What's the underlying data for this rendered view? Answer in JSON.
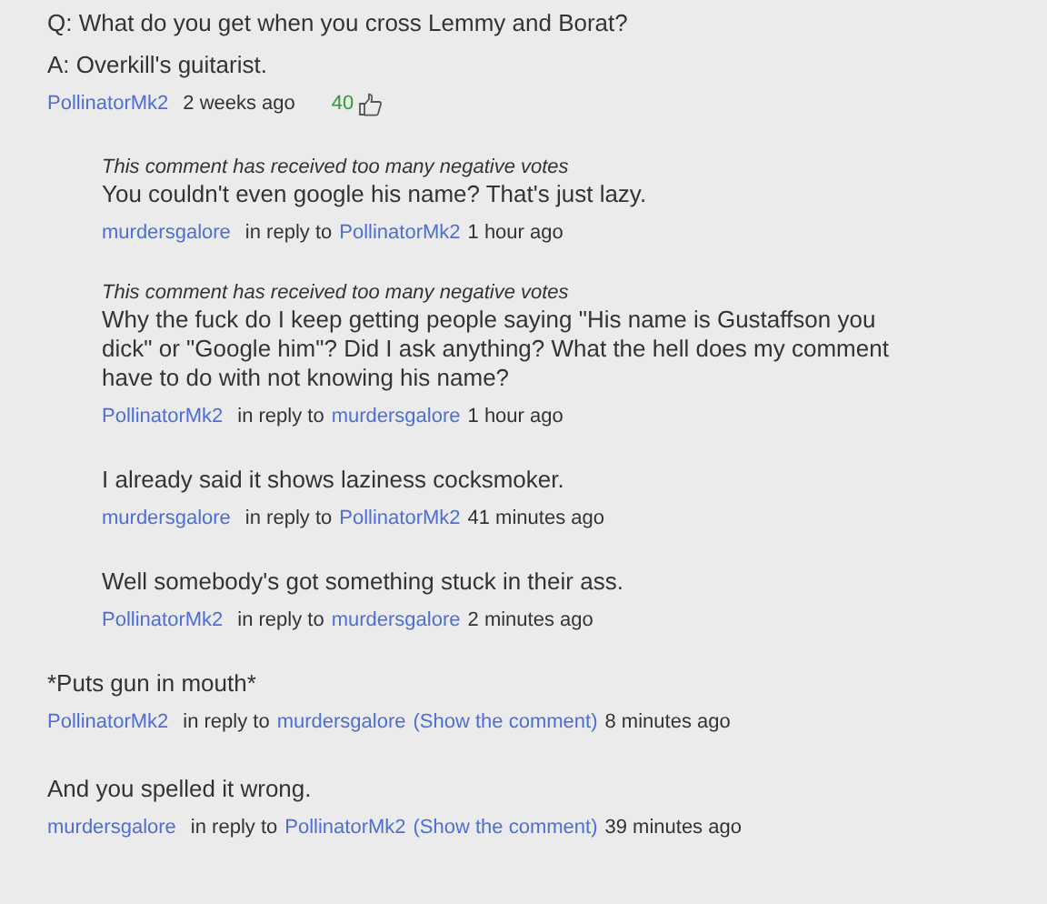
{
  "comments": [
    {
      "lines": [
        "Q: What do you get when you cross Lemmy and Borat?",
        "A: Overkill's guitarist."
      ],
      "author": "PollinatorMk2",
      "time": "2 weeks ago",
      "likes": "40",
      "children": [
        {
          "notice": "This comment has received too many negative votes",
          "lines": [
            "You couldn't even google his name? That's just lazy."
          ],
          "author": "murdersgalore",
          "reply_label": "in reply to",
          "reply_to": "PollinatorMk2",
          "time": "1 hour ago"
        },
        {
          "notice": "This comment has received too many negative votes",
          "lines": [
            "Why the fuck do I keep getting people saying \"His name is Gustaffson you dick\" or \"Google him\"? Did I ask anything? What the hell does my comment have to do with not knowing his name?"
          ],
          "author": "PollinatorMk2",
          "reply_label": "in reply to",
          "reply_to": "murdersgalore",
          "time": "1 hour ago"
        },
        {
          "lines": [
            "I already said it shows laziness cocksmoker."
          ],
          "author": "murdersgalore",
          "reply_label": "in reply to",
          "reply_to": "PollinatorMk2",
          "time": "41 minutes ago"
        },
        {
          "lines": [
            "Well somebody's got something stuck in their ass."
          ],
          "author": "PollinatorMk2",
          "reply_label": "in reply to",
          "reply_to": "murdersgalore",
          "time": "2 minutes ago"
        }
      ]
    },
    {
      "lines": [
        "*Puts gun in mouth*"
      ],
      "author": "PollinatorMk2",
      "reply_label": "in reply to",
      "reply_to": "murdersgalore",
      "show_link": "(Show the comment)",
      "time": "8 minutes ago"
    },
    {
      "lines": [
        "And you spelled it wrong."
      ],
      "author": "murdersgalore",
      "reply_label": "in reply to",
      "reply_to": "PollinatorMk2",
      "show_link": "(Show the comment)",
      "time": "39 minutes ago"
    }
  ]
}
